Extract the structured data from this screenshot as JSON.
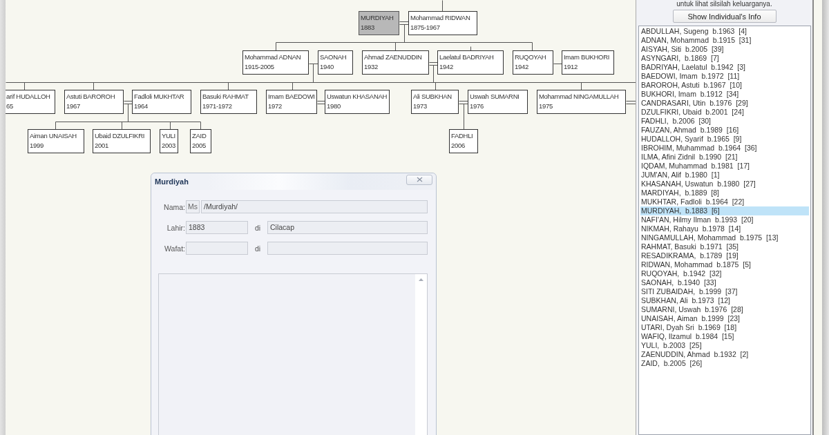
{
  "tree": {
    "nodes": [
      {
        "name": "MURDIYAH",
        "years": "1883",
        "selected": true
      },
      {
        "name": "Mohammad RIDWAN",
        "years": "1875-1967",
        "selected": false
      },
      {
        "name": "Mohammad ADNAN",
        "years": "1915-2005",
        "selected": false
      },
      {
        "name": "SAONAH",
        "years": "1940",
        "selected": false
      },
      {
        "name": "Ahmad ZAENUDDIN",
        "years": "1932",
        "selected": false
      },
      {
        "name": "Laelatul BADRIYAH",
        "years": "1942",
        "selected": false
      },
      {
        "name": "RUQOYAH",
        "years": "1942",
        "selected": false
      },
      {
        "name": "Imam BUKHORI",
        "years": "1912",
        "selected": false
      },
      {
        "name": "arif HUDALLOH",
        "years": "65",
        "selected": false
      },
      {
        "name": "Astuti BAROROH",
        "years": "1967",
        "selected": false
      },
      {
        "name": "Fadloli MUKHTAR",
        "years": "1964",
        "selected": false
      },
      {
        "name": "Basuki RAHMAT",
        "years": "1971-1972",
        "selected": false
      },
      {
        "name": "Imam BAEDOWI",
        "years": "1972",
        "selected": false
      },
      {
        "name": "Uswatun KHASANAH",
        "years": "1980",
        "selected": false
      },
      {
        "name": "Ali SUBKHAN",
        "years": "1973",
        "selected": false
      },
      {
        "name": "Uswah SUMARNI",
        "years": "1976",
        "selected": false
      },
      {
        "name": "Mohammad NINGAMULLAH",
        "years": "1975",
        "selected": false
      },
      {
        "name": "Aiman UNAISAH",
        "years": "1999",
        "selected": false
      },
      {
        "name": "Ubaid DZULFIKRI",
        "years": "2001",
        "selected": false
      },
      {
        "name": "YULI",
        "years": "2003",
        "selected": false
      },
      {
        "name": "ZAID",
        "years": "2005",
        "selected": false
      },
      {
        "name": "FADHLI",
        "years": "2006",
        "selected": false
      }
    ]
  },
  "side_panel": {
    "hint": "untuk lihat silsilah keluarganya.",
    "button": "Show Individual's Info",
    "people": [
      {
        "label": "ABDULLAH, Sugeng  b.1963  [4]",
        "selected": false
      },
      {
        "label": "ADNAN, Mohammad  b.1915  [31]",
        "selected": false
      },
      {
        "label": "AISYAH, Siti  b.2005  [39]",
        "selected": false
      },
      {
        "label": "ASYNGARI,  b.1869  [7]",
        "selected": false
      },
      {
        "label": "BADRIYAH, Laelatul  b.1942  [3]",
        "selected": false
      },
      {
        "label": "BAEDOWI, Imam  b.1972  [11]",
        "selected": false
      },
      {
        "label": "BAROROH, Astuti  b.1967  [10]",
        "selected": false
      },
      {
        "label": "BUKHORI, Imam  b.1912  [34]",
        "selected": false
      },
      {
        "label": "CANDRASARI, Utin  b.1976  [29]",
        "selected": false
      },
      {
        "label": "DZULFIKRI, Ubaid  b.2001  [24]",
        "selected": false
      },
      {
        "label": "FADHLI,  b.2006  [30]",
        "selected": false
      },
      {
        "label": "FAUZAN, Ahmad  b.1989  [16]",
        "selected": false
      },
      {
        "label": "HUDALLOH, Syarif  b.1965  [9]",
        "selected": false
      },
      {
        "label": "IBROHIM, Muhammad  b.1964  [36]",
        "selected": false
      },
      {
        "label": "ILMA, Afini Zidnil  b.1990  [21]",
        "selected": false
      },
      {
        "label": "IQDAM, Muhammad  b.1981  [17]",
        "selected": false
      },
      {
        "label": "JUM'AN, Alif  b.1980  [1]",
        "selected": false
      },
      {
        "label": "KHASANAH, Uswatun  b.1980  [27]",
        "selected": false
      },
      {
        "label": "MARDIYAH,  b.1889  [8]",
        "selected": false
      },
      {
        "label": "MUKHTAR, Fadloli  b.1964  [22]",
        "selected": false
      },
      {
        "label": "MURDIYAH,  b.1883  [6]",
        "selected": true
      },
      {
        "label": "NAFI'AN, Hilmy Ilman  b.1993  [20]",
        "selected": false
      },
      {
        "label": "NIKMAH, Rahayu  b.1978  [14]",
        "selected": false
      },
      {
        "label": "NINGAMULLAH, Mohammad  b.1975  [13]",
        "selected": false
      },
      {
        "label": "RAHMAT, Basuki  b.1971  [35]",
        "selected": false
      },
      {
        "label": "RESADIKRAMA,  b.1789  [19]",
        "selected": false
      },
      {
        "label": "RIDWAN, Mohammad  b.1875  [5]",
        "selected": false
      },
      {
        "label": "RUQOYAH,  b.1942  [32]",
        "selected": false
      },
      {
        "label": "SAONAH,  b.1940  [33]",
        "selected": false
      },
      {
        "label": "SITI ZUBAIDAH,  b.1999  [37]",
        "selected": false
      },
      {
        "label": "SUBKHAN, Ali  b.1973  [12]",
        "selected": false
      },
      {
        "label": "SUMARNI, Uswah  b.1976  [28]",
        "selected": false
      },
      {
        "label": "UNAISAH, Aiman  b.1999  [23]",
        "selected": false
      },
      {
        "label": "UTARI, Dyah Sri  b.1969  [18]",
        "selected": false
      },
      {
        "label": "WAFIQ, Ilzamul  b.1984  [15]",
        "selected": false
      },
      {
        "label": "YULI,  b.2003  [25]",
        "selected": false
      },
      {
        "label": "ZAENUDDIN, Ahmad  b.1932  [2]",
        "selected": false
      },
      {
        "label": "ZAID,  b.2005  [26]",
        "selected": false
      }
    ]
  },
  "dialog": {
    "title": "Murdiyah",
    "name_label": "Nama:",
    "title_value": "Ms",
    "name_value": "/Murdiyah/",
    "born_label": "Lahir:",
    "born_value": "1883",
    "born_place_label": "di",
    "born_place_value": "Cilacap",
    "died_label": "Wafat:",
    "died_place_label": "di"
  }
}
